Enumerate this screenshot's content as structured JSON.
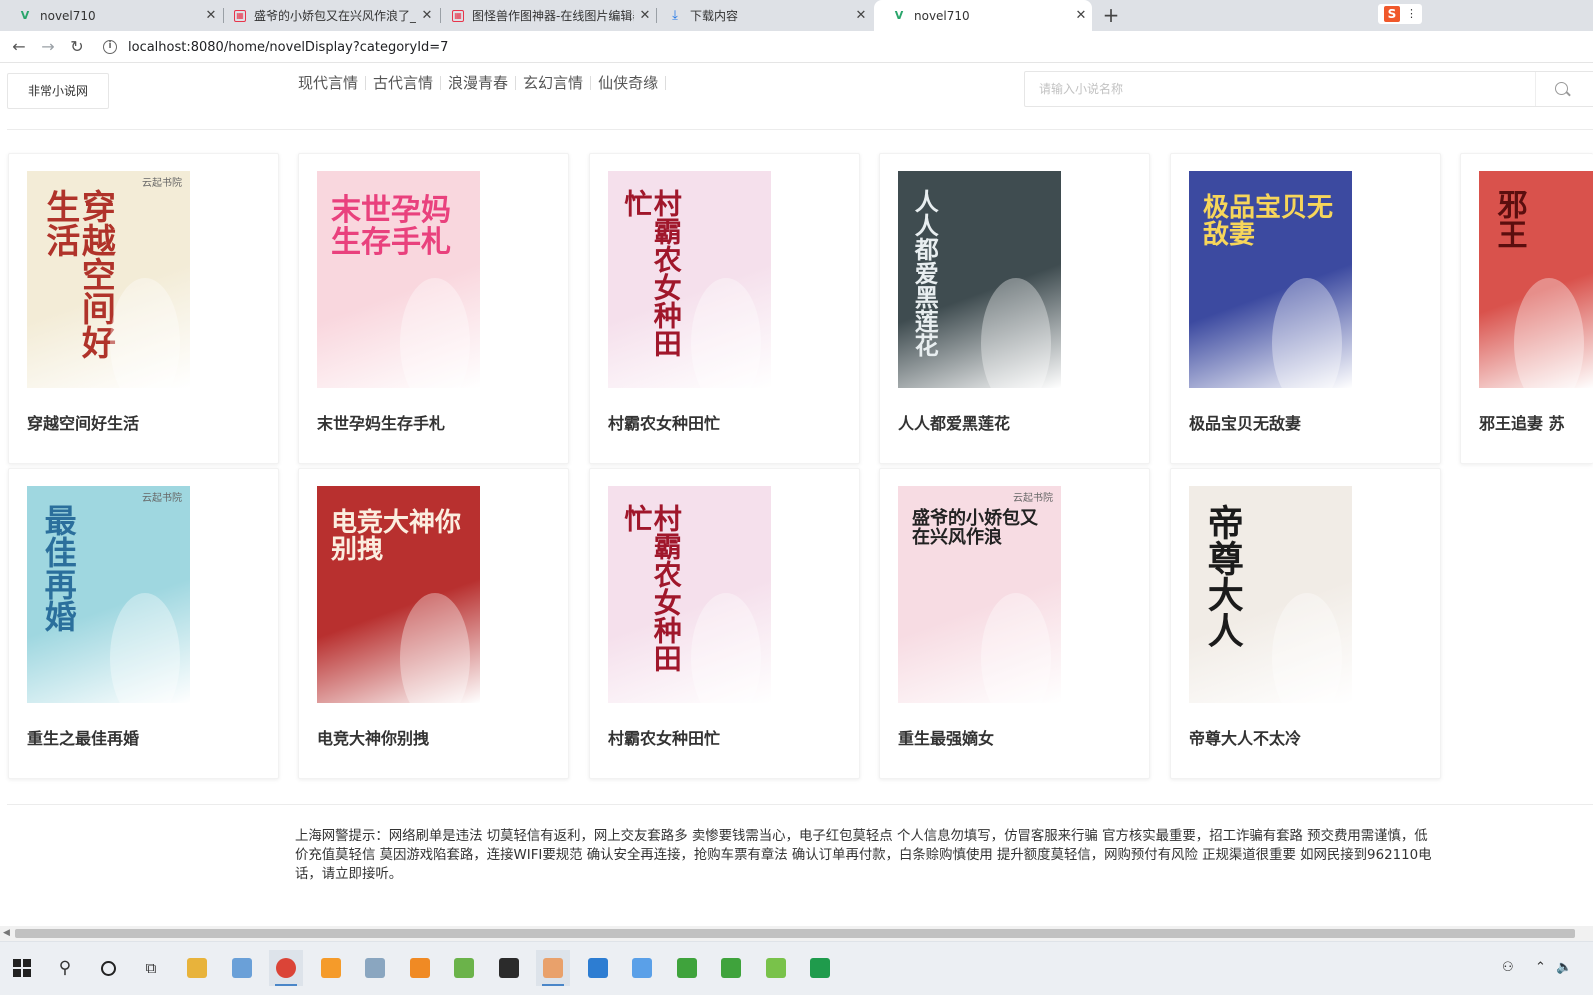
{
  "browser": {
    "tabs": [
      {
        "title": "novel710",
        "icon": "vue-icon",
        "active": false
      },
      {
        "title": "盛爷的小娇包又在兴风作浪了_新",
        "icon": "image-icon",
        "active": false
      },
      {
        "title": "图怪兽作图神器-在线图片编辑器",
        "icon": "image-icon",
        "active": false
      },
      {
        "title": "下载内容",
        "icon": "download-icon",
        "active": false
      },
      {
        "title": "novel710",
        "icon": "vue-icon",
        "active": true
      }
    ],
    "url": "localhost:8080/home/novelDisplay?categoryId=7",
    "extension_label": "S"
  },
  "header": {
    "logo": "非常小说网",
    "categories": [
      "现代言情",
      "古代言情",
      "浪漫青春",
      "玄幻言情",
      "仙侠奇缘"
    ],
    "search_placeholder": "请输入小说名称"
  },
  "books": [
    {
      "title": "穿越空间好生活",
      "cover_text": "穿越空间好生活",
      "cover_publisher": "云起书院",
      "bg": "#f3ecd7",
      "fg": "#b0332a"
    },
    {
      "title": "末世孕妈生存手札",
      "cover_text": "末世孕妈生存手札",
      "cover_publisher": "",
      "bg": "#f9d7de",
      "fg": "#e9417d"
    },
    {
      "title": "村霸农女种田忙",
      "cover_text": "村霸农女种田忙",
      "cover_publisher": "",
      "bg": "#f5e0ec",
      "fg": "#a0172b"
    },
    {
      "title": "人人都爱黑莲花",
      "cover_text": "人人都爱黑莲花",
      "cover_publisher": "",
      "bg": "#3f4c50",
      "fg": "#e8eef0"
    },
    {
      "title": "极品宝贝无敌妻",
      "cover_text": "极品宝贝无敌妻",
      "cover_publisher": "",
      "bg": "#3c4aa0",
      "fg": "#f7d65a"
    },
    {
      "title": "邪王追妻 苏",
      "cover_text": "邪王",
      "cover_publisher": "",
      "bg": "#d9524c",
      "fg": "#5b0e0e"
    },
    {
      "title": "重生之最佳再婚",
      "cover_text": "最佳再婚",
      "cover_publisher": "云起书院",
      "bg": "#9fd7e0",
      "fg": "#2b6f9c"
    },
    {
      "title": "电竞大神你别拽",
      "cover_text": "电竞大神你别拽",
      "cover_publisher": "",
      "bg": "#b8302f",
      "fg": "#fbeee0"
    },
    {
      "title": "村霸农女种田忙",
      "cover_text": "村霸农女种田忙",
      "cover_publisher": "",
      "bg": "#f5e0ec",
      "fg": "#a0172b"
    },
    {
      "title": "重生最强嫡女",
      "cover_text": "盛爷的小娇包又在兴风作浪",
      "cover_publisher": "云起书院",
      "bg": "#f7dce3",
      "fg": "#222"
    },
    {
      "title": "帝尊大人不太冷",
      "cover_text": "帝尊大人",
      "cover_publisher": "",
      "bg": "#f1ece6",
      "fg": "#1b1b1b"
    }
  ],
  "footer": {
    "notice": "上海网警提示：网络刷单是违法 切莫轻信有返利，网上交友套路多 卖惨要钱需当心，电子红包莫轻点 个人信息勿填写，仿冒客服来行骗 官方核实最重要，招工诈骗有套路 预交费用需谨慎，低价充值莫轻信 莫因游戏陷套路，连接WIFI要规范 确认安全再连接，抢购车票有章法 确认订单再付款，白条赊购慎使用 提升额度莫轻信，网购预付有风险 正规渠道很重要 如网民接到962110电话，请立即接听。"
  },
  "taskbar": {
    "apps": [
      "file-explorer",
      "app",
      "chrome",
      "app",
      "app",
      "search-app",
      "app",
      "intellij",
      "app",
      "app",
      "app",
      "app",
      "app",
      "app",
      "hbuilder"
    ]
  }
}
